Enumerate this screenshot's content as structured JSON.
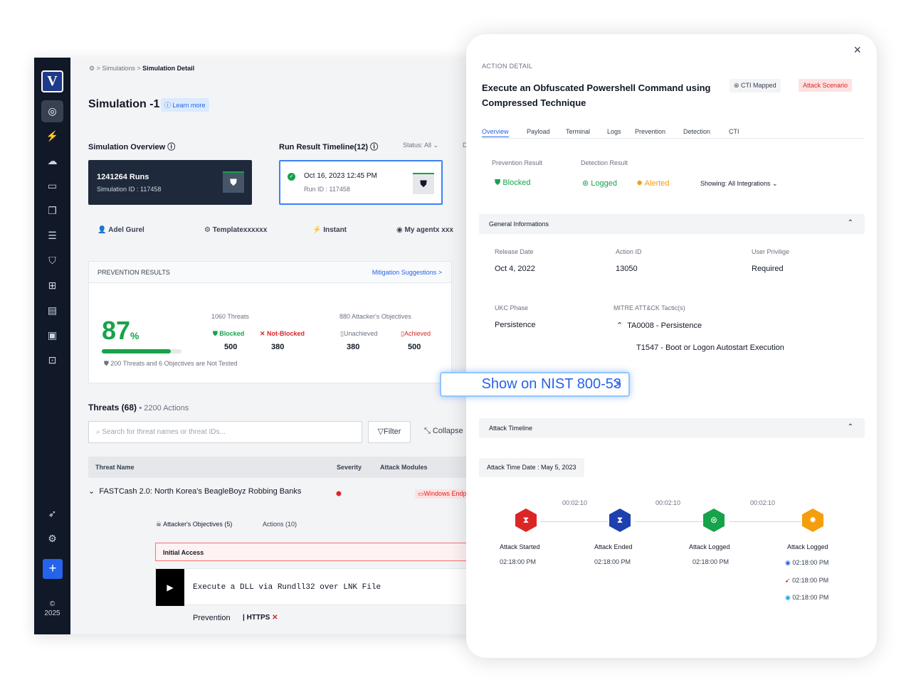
{
  "sidebar": {
    "logo": "V",
    "copyright": "©",
    "year": "2025",
    "plus": "+"
  },
  "breadcrumb": {
    "home_icon": "gear",
    "sep": ">",
    "items": [
      "Simulations",
      "Simulation Detail"
    ]
  },
  "page": {
    "title": "Simulation -1",
    "learn_more": "ⓘ Learn more"
  },
  "overview": {
    "title": "Simulation Overview ⓘ",
    "runs": "1241264 Runs",
    "sim_id": "Simulation ID : 117458"
  },
  "timeline": {
    "title": "Run Result Timeline(12) ⓘ",
    "status": "Status: All ⌄",
    "d": "D",
    "run_date": "Oct 16, 2023 12:45 PM",
    "run_id": "Run ID : 117458"
  },
  "meta": {
    "user": "Adel Gurel",
    "template": "Templatexxxxxx",
    "mode": "Instant",
    "agent": "My agentx xxx"
  },
  "prevention": {
    "title": "PREVENTION RESULTS",
    "mitigation": "Mitigation Suggestions >",
    "percent": "87",
    "pct_sign": "%",
    "progress": 0.87,
    "threats_title": "1060 Threats",
    "blocked": "Blocked",
    "not_blocked": "Not-Blocked",
    "blocked_n": "500",
    "not_blocked_n": "380",
    "obj_title": "880 Attacker's Objectives",
    "unachieved": "Unachieved",
    "achieved": "Achieved",
    "unachieved_n": "380",
    "achieved_n": "500",
    "not_tested": "200 Threats and 6 Objectives are Not Tested"
  },
  "threats": {
    "title": "Threats (68)",
    "actions": "• 2200 Actions",
    "search_placeholder": "Search for threat names or threat IDs...",
    "filter": "Filter",
    "collapse": "Collapse",
    "col_name": "Threat Name",
    "col_severity": "Severity",
    "col_modules": "Attack Modules",
    "row1": "FASTCash 2.0: North Korea's BeagleBoyz Robbing Banks",
    "row1_module": "Windows Endpoint",
    "objectives": "Attacker's Objectives (5)",
    "actions_count": "Actions (10)",
    "initial_access": "Initial Access",
    "action": "Execute a DLL via Rundll32 over LNK File",
    "prevention": "Prevention",
    "https": "HTTPS"
  },
  "panel": {
    "label": "ACTION DETAIL",
    "title": "Execute an Obfuscated Powershell Command using Compressed Technique",
    "cti_badge": "CTI Mapped",
    "scenario_badge": "Attack Scenario",
    "close": "×",
    "tabs": [
      "Overview",
      "Payload",
      "Terminal",
      "Logs",
      "Prevention",
      "Detection",
      "CTI"
    ],
    "prev_result_label": "Prevention Result",
    "prev_result": "Blocked",
    "det_result_label": "Detection Result",
    "logged": "Logged",
    "alerted": "Alerted",
    "showing": "Showing: All Integrations ⌄",
    "general": "General Informations",
    "release_label": "Release Date",
    "release": "Oct 4, 2022",
    "action_id_label": "Action ID",
    "action_id": "13050",
    "privilege_label": "User Privilige",
    "privilege": "Required",
    "ukc_label": "UKC Phase",
    "ukc": "Persistence",
    "mitre_label": "MITRE ATT&CK Tactic(s)",
    "tactic": "TA0008 - Persistence",
    "technique": "T1547 - Boot or Logon Autostart Execution",
    "timeline_title": "Attack Timeline",
    "attack_date": "Attack Time Date : May 5, 2023",
    "durations": [
      "00:02:10",
      "00:02:10",
      "00:02:10"
    ],
    "events": [
      {
        "label": "Attack Started",
        "time": "02:18:00 PM",
        "color": "#dc2626"
      },
      {
        "label": "Attack Ended",
        "time": "02:18:00 PM",
        "color": "#1e40af"
      },
      {
        "label": "Attack Logged",
        "time": "02:18:00 PM",
        "color": "#16a34a"
      },
      {
        "label": "Attack Logged",
        "time": "02:18:00 PM",
        "color": "#f59e0b"
      }
    ],
    "extra_times": [
      "02:18:00 PM",
      "02:18:00 PM"
    ]
  },
  "nist": {
    "label": "Show on NIST 800-53",
    "chevron": ">"
  }
}
